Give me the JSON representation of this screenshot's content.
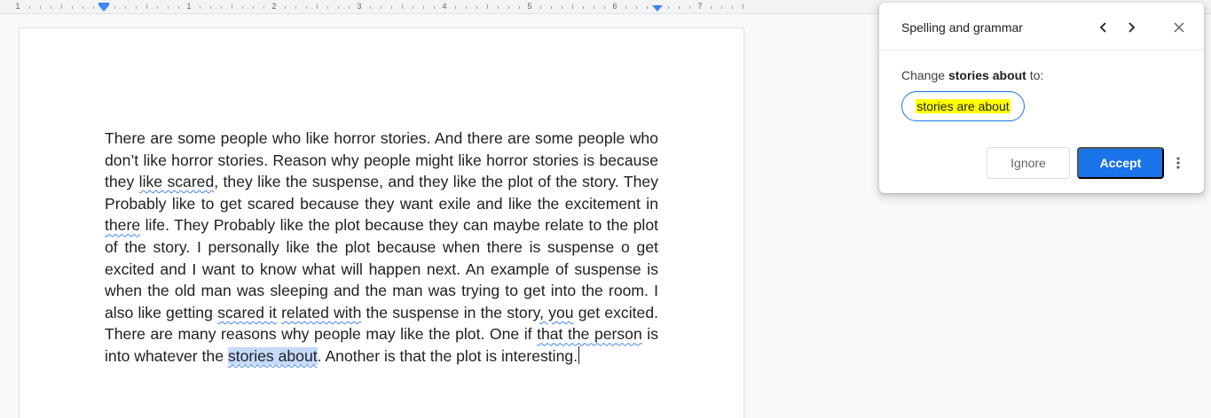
{
  "ruler": {
    "numbers": [
      "1",
      "1",
      "2",
      "3",
      "4",
      "5",
      "6",
      "7"
    ]
  },
  "document": {
    "p1": "There are some people who like horror stories. And there are some people who don’t like horror stories. Reason why people might like horror stories is because they ",
    "s1": "like scared",
    "p2": ", they like the suspense, and they like the plot of the story. They Probably like to get scared because they want exile and like the excitement in ",
    "s2": "there",
    "p3": " life. They Probably like the plot because they can maybe relate to the plot of the story. I personally like the plot because when there is suspense o get excited and I want to know what will happen next. An example of suspense is when the old man was sleeping and the man was trying to get into the room. I also like getting ",
    "s3": "scared it",
    "p4": " ",
    "s4": "related with",
    "p5": " the suspense in the story",
    "s5": ", you",
    "p6": " get excited. There are many reasons why people may like the plot. One if ",
    "s6": "that the person",
    "p7": " is into whatever the ",
    "s7": "stories about",
    "p8": ". Another is that the plot is interesting."
  },
  "panel": {
    "title": "Spelling and grammar",
    "prev_icon": "chevron-left-icon",
    "next_icon": "chevron-right-icon",
    "close_icon": "close-icon",
    "change_prefix": "Change ",
    "change_target": "stories about",
    "change_suffix": " to:",
    "suggestion": "stories are about",
    "ignore_label": "Ignore",
    "accept_label": "Accept",
    "more_icon": "more-vert-icon"
  },
  "colors": {
    "accent": "#1a73e8",
    "highlight": "#ffff00",
    "selection": "#c6dafc",
    "squiggle": "#4285f4"
  }
}
